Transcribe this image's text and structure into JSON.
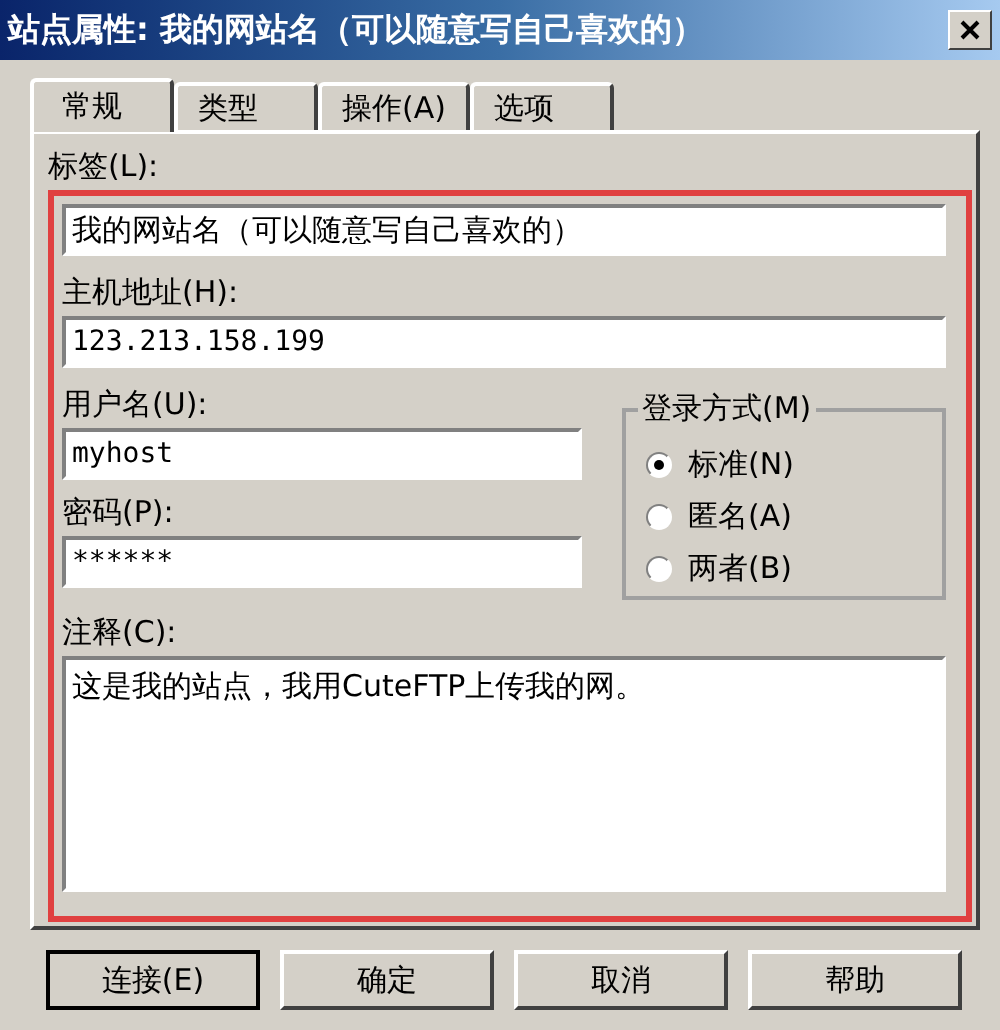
{
  "window": {
    "title": "站点属性: 我的网站名（可以随意写自己喜欢的）"
  },
  "tabs": [
    {
      "label": "常规",
      "selected": true
    },
    {
      "label": "类型",
      "selected": false
    },
    {
      "label": "操作(A)",
      "selected": false
    },
    {
      "label": "选项",
      "selected": false
    }
  ],
  "form": {
    "highlighted": true,
    "label_field": {
      "label": "标签(L):",
      "value": "我的网站名（可以随意写自己喜欢的）"
    },
    "host_field": {
      "label": "主机地址(H):",
      "value": "123.213.158.199"
    },
    "user_field": {
      "label": "用户名(U):",
      "value": "myhost"
    },
    "password_field": {
      "label": "密码(P):",
      "value": "******"
    },
    "login_mode": {
      "title": "登录方式(M)",
      "options": [
        {
          "label": "标准(N)",
          "selected": true
        },
        {
          "label": "匿名(A)",
          "selected": false
        },
        {
          "label": "两者(B)",
          "selected": false
        }
      ]
    },
    "comment_field": {
      "label": "注释(C):",
      "value": "这是我的站点，我用CuteFTP上传我的网。"
    }
  },
  "buttons": [
    {
      "label": "连接(E)",
      "default": true
    },
    {
      "label": "确定",
      "default": false
    },
    {
      "label": "取消",
      "default": false
    },
    {
      "label": "帮助",
      "default": false
    }
  ]
}
